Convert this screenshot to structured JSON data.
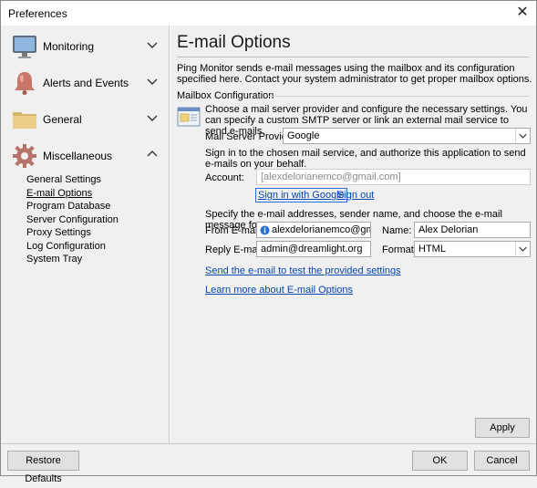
{
  "window": {
    "title": "Preferences",
    "close_glyph": "✕"
  },
  "sidebar": {
    "categories": [
      {
        "label": "Monitoring",
        "icon": "monitor-icon",
        "expanded": false
      },
      {
        "label": "Alerts and Events",
        "icon": "bell-icon",
        "expanded": false
      },
      {
        "label": "General",
        "icon": "folder-icon",
        "expanded": false
      },
      {
        "label": "Miscellaneous",
        "icon": "gear-icon",
        "expanded": true
      }
    ],
    "subitems": [
      "General Settings",
      "E-mail Options",
      "Program Database",
      "Server Configuration",
      "Proxy Settings",
      "Log Configuration",
      "System Tray"
    ],
    "active_subitem": "E-mail Options"
  },
  "main": {
    "title": "E-mail Options",
    "description": "Ping Monitor sends e-mail messages using the mailbox and its configuration specified here. Contact your system administrator to get proper mailbox options.",
    "group_label": "Mailbox Configuration",
    "provider_description": "Choose a mail server provider and configure the necessary settings. You can specify a custom SMTP server or link an external mail service to send e-mails.",
    "provider_label": "Mail Server Provider:",
    "provider_value": "Google",
    "signin_text": "Sign in to the chosen mail service, and authorize this application to send e-mails on your behalf.",
    "account_label": "Account:",
    "account_value": "[alexdelorianemco@gmail.com]",
    "signin_link": "Sign in with Google",
    "signout_link": "Sign out",
    "specify_text": "Specify the e-mail addresses, sender name, and choose the e-mail message format.",
    "from_label": "From E-mail:",
    "from_value": "alexdelorianemco@gmail.com",
    "name_label": "Name:",
    "name_value": "Alex Delorian",
    "reply_label": "Reply E-mail:",
    "reply_value": "admin@dreamlight.org",
    "format_label": "Format:",
    "format_value": "HTML",
    "test_link": "Send the e-mail to test the provided settings",
    "learn_link": "Learn more about E-mail Options",
    "apply_label": "Apply"
  },
  "footer": {
    "restore_label": "Restore Defaults",
    "ok_label": "OK",
    "cancel_label": "Cancel"
  },
  "colors": {
    "accent": "#0645ad",
    "info_icon": "#2a6fd6"
  }
}
